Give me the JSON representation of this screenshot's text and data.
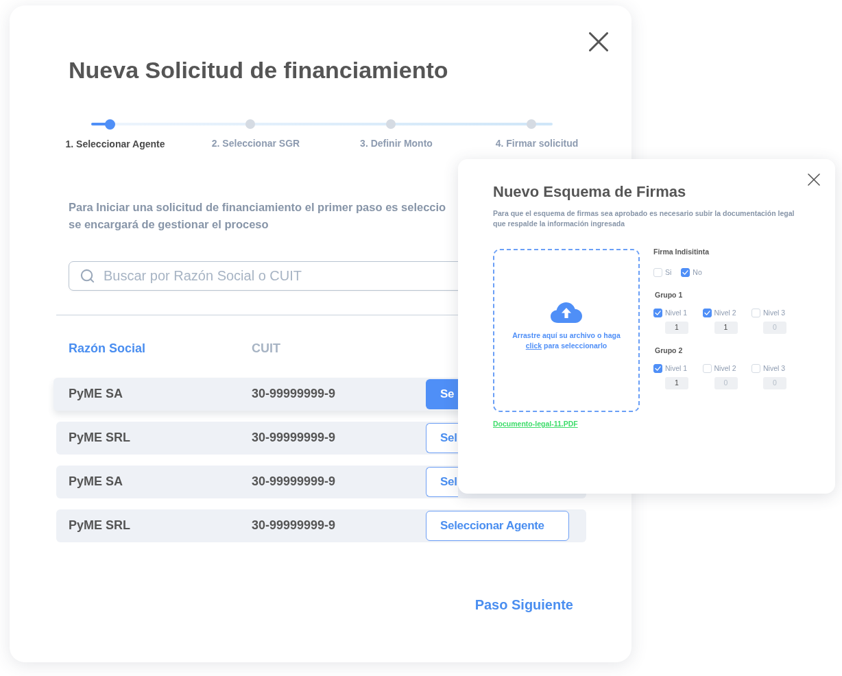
{
  "dialog": {
    "title": "Nueva Solicitud de financiamiento",
    "steps": [
      {
        "label": "1. Seleccionar Agente",
        "selected": true
      },
      {
        "label": "2. Seleccionar SGR",
        "selected": false
      },
      {
        "label": "3. Definir Monto",
        "selected": false
      },
      {
        "label": "4. Firmar solicitud",
        "selected": false
      }
    ],
    "intro_lines": [
      "Para Iniciar una solicitud de financiamiento el primer paso es seleccio",
      "se encargará de gestionar el proceso"
    ],
    "search": {
      "placeholder": "Buscar por Razón Social o CUIT"
    },
    "table": {
      "columns": [
        {
          "label": "Razón Social",
          "selected": true
        },
        {
          "label": "CUIT",
          "selected": false
        }
      ],
      "rows": [
        {
          "name": "PyME SA",
          "cuit": "30-99999999-9",
          "button": "Se",
          "selected": true
        },
        {
          "name": "PyME SRL",
          "cuit": "30-99999999-9",
          "button": "Sel",
          "selected": false
        },
        {
          "name": "PyME SA",
          "cuit": "30-99999999-9",
          "button": "Sel",
          "selected": false
        },
        {
          "name": "PyME SRL",
          "cuit": "30-99999999-9",
          "button": "Seleccionar Agente",
          "selected": false
        }
      ]
    },
    "next_button": "Paso Siguiente"
  },
  "signatures_dialog": {
    "title": "Nuevo Esquema de Firmas",
    "description": "Para que el esquema de firmas sea aprobado es necesario subir la documentación legal que respalde la información ingresada",
    "dropzone": {
      "text_before": "Arrastre aquí su archivo o haga",
      "link": "click",
      "text_after": "para seleccionarlo"
    },
    "file": "Documento-legal-11.PDF",
    "firma_indistinta": {
      "label": "Firma Indisitinta",
      "options": [
        {
          "label": "Si",
          "checked": false
        },
        {
          "label": "No",
          "checked": true
        }
      ]
    },
    "groups": [
      {
        "title": "Grupo 1",
        "levels": [
          {
            "label": "Nivel 1",
            "checked": true,
            "value": "1"
          },
          {
            "label": "Nivel 2",
            "checked": true,
            "value": "1"
          },
          {
            "label": "Nivel 3",
            "checked": false,
            "value": "0"
          }
        ]
      },
      {
        "title": "Grupo 2",
        "levels": [
          {
            "label": "Nivel 1",
            "checked": true,
            "value": "1"
          },
          {
            "label": "Nivel 2",
            "checked": false,
            "value": "0"
          },
          {
            "label": "Nivel 3",
            "checked": false,
            "value": "0"
          }
        ]
      }
    ]
  }
}
